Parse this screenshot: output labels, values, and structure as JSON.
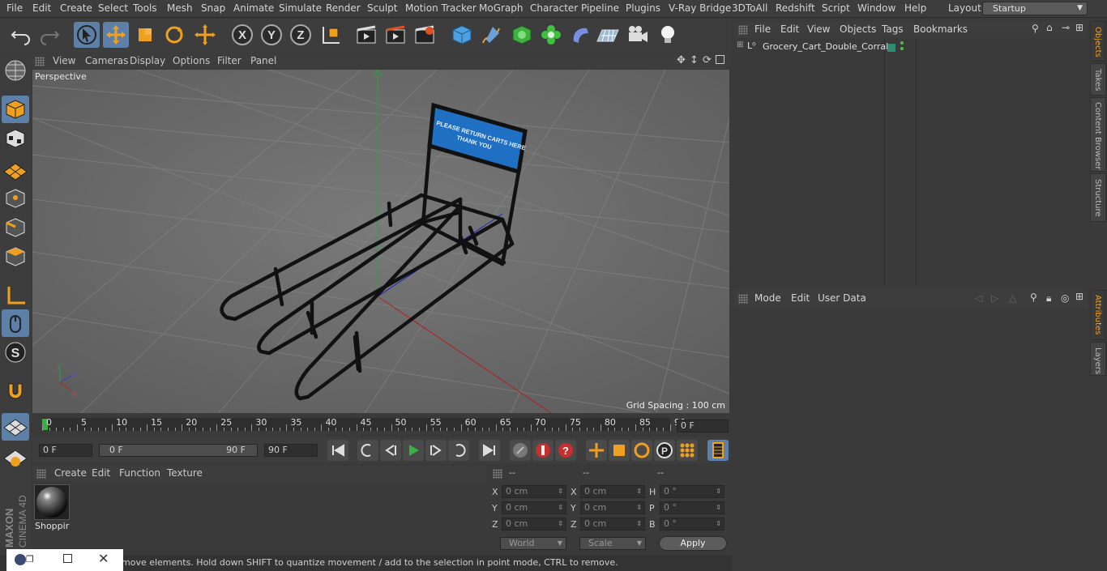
{
  "menubar": {
    "items": [
      "File",
      "Edit",
      "Create",
      "Select",
      "Tools",
      "Mesh",
      "Snap",
      "Animate",
      "Simulate",
      "Render",
      "Sculpt",
      "Motion Tracker",
      "MoGraph",
      "Character",
      "Pipeline",
      "Plugins",
      "V-Ray Bridge",
      "3DToAll",
      "Redshift",
      "Script",
      "Window",
      "Help"
    ],
    "layout_label": "Layout:",
    "layout_value": "Startup"
  },
  "toolbar": {
    "axis_x": "X",
    "axis_y": "Y",
    "axis_z": "Z"
  },
  "viewport": {
    "menu": [
      "View",
      "Cameras",
      "Display",
      "Options",
      "Filter",
      "Panel"
    ],
    "camera_label": "Perspective",
    "grid_spacing": "Grid Spacing : 100 cm",
    "sign_line1": "PLEASE RETURN CARTS HERE",
    "sign_line2": "THANK YOU",
    "axis_y": "Y",
    "axis_z": "Z",
    "axis_x": "X"
  },
  "timeline": {
    "ticks": [
      "0",
      "5",
      "10",
      "15",
      "20",
      "25",
      "30",
      "35",
      "40",
      "45",
      "50",
      "55",
      "60",
      "65",
      "70",
      "75",
      "80",
      "85",
      "90"
    ],
    "current_frame": "0 F"
  },
  "controls": {
    "start_frame": "0 F",
    "range_start": "0 F",
    "range_end": "90 F",
    "end_frame": "90 F"
  },
  "material_manager": {
    "menu": [
      "Create",
      "Edit",
      "Function",
      "Texture"
    ],
    "material_name": "Shoppir"
  },
  "coordinates": {
    "header": [
      "--",
      "--",
      "--"
    ],
    "rows": [
      {
        "l1": "X",
        "v1": "0 cm",
        "l2": "X",
        "v2": "0 cm",
        "l3": "H",
        "v3": "0 °"
      },
      {
        "l1": "Y",
        "v1": "0 cm",
        "l2": "Y",
        "v2": "0 cm",
        "l3": "P",
        "v3": "0 °"
      },
      {
        "l1": "Z",
        "v1": "0 cm",
        "l2": "Z",
        "v2": "0 cm",
        "l3": "B",
        "v3": "0 °"
      }
    ],
    "mode_select": "World",
    "scale_select": "Scale",
    "apply_label": "Apply"
  },
  "status_text": "move elements. Hold down SHIFT to quantize movement / add to the selection in point mode, CTRL to remove.",
  "object_manager": {
    "menu": [
      "File",
      "Edit",
      "View",
      "Objects",
      "Tags",
      "Bookmarks"
    ],
    "object_name": "Grocery_Cart_Double_Corral"
  },
  "attribute_manager": {
    "menu": [
      "Mode",
      "Edit",
      "User Data"
    ]
  },
  "right_tabs": [
    "Objects",
    "Takes",
    "Content Browser",
    "Structure",
    "Attributes",
    "Layers"
  ],
  "brand": {
    "maxon": "MAXON",
    "product": "CINEMA 4D"
  },
  "colors": {
    "accent": "#5d80a8",
    "sign_blue": "#1f6fc2"
  }
}
